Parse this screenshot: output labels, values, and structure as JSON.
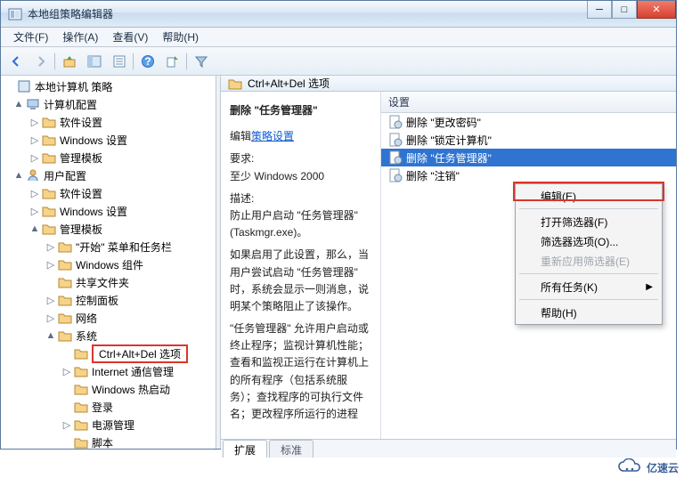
{
  "title": "本地组策略编辑器",
  "menu": {
    "file": "文件(F)",
    "action": "操作(A)",
    "view": "查看(V)",
    "help": "帮助(H)"
  },
  "tree": {
    "root": "本地计算机 策略",
    "computer": "计算机配置",
    "c_soft": "软件设置",
    "c_win": "Windows 设置",
    "c_tmpl": "管理模板",
    "user": "用户配置",
    "u_soft": "软件设置",
    "u_win": "Windows 设置",
    "u_tmpl": "管理模板",
    "start": "\"开始\" 菜单和任务栏",
    "wincomp": "Windows 组件",
    "shared": "共享文件夹",
    "ctrl": "控制面板",
    "net": "网络",
    "sys": "系统",
    "cad": "Ctrl+Alt+Del 选项",
    "inet": "Internet 通信管理",
    "hotboot": "Windows 热启动",
    "logon": "登录",
    "power": "电源管理",
    "script": "脚本"
  },
  "breadcrumb": "Ctrl+Alt+Del 选项",
  "detail": {
    "heading": "删除 \"任务管理器\"",
    "edit_prefix": "编辑",
    "edit_link": "策略设置",
    "req_label": "要求:",
    "req_val": "至少 Windows 2000",
    "desc_label": "描述:",
    "desc1": "防止用户启动 \"任务管理器\"(Taskmgr.exe)。",
    "desc2": "如果启用了此设置，那么，当用户尝试启动 \"任务管理器\" 时，系统会显示一则消息，说明某个策略阻止了该操作。",
    "desc3": "\"任务管理器\" 允许用户启动或终止程序；监视计算机性能；查看和监视正运行在计算机上的所有程序（包括系统服务）；查找程序的可执行文件名；更改程序所运行的进程"
  },
  "list": {
    "header": "设置",
    "items": [
      "删除 \"更改密码\"",
      "删除 \"锁定计算机\"",
      "删除 \"任务管理器\"",
      "删除 \"注销\""
    ]
  },
  "tabs": {
    "ext": "扩展",
    "std": "标准"
  },
  "ctx": {
    "edit": "编辑(E)",
    "openfilter": "打开筛选器(F)",
    "filteropts": "筛选器选项(O)...",
    "reapply": "重新应用筛选器(E)",
    "alltasks": "所有任务(K)",
    "help": "帮助(H)"
  },
  "watermark": "亿速云"
}
